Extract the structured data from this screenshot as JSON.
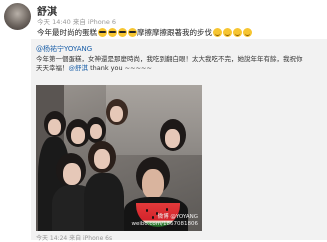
{
  "user": {
    "name": "舒淇",
    "meta": "今天 14:40 来自 iPhone 6"
  },
  "post": {
    "text": "今年最时尚的蛋糕",
    "text_after": "摩擦摩擦跟著我的步伐",
    "emojis_sunglasses": [
      "sunglasses",
      "sunglasses",
      "sunglasses",
      "sunglasses"
    ],
    "emojis_cute": [
      "cute",
      "cute",
      "cute",
      "cute"
    ]
  },
  "repost": {
    "author": "@杨祐宁YOYANG",
    "text_line1": "今年第一個蛋糕，女神還是那麼時尚，我吃到翻白眼！太大我吃不完，她說年年有餘，我祝你",
    "text_line2_prefix": "天天幸福！",
    "mention": "@舒淇",
    "text_line2_suffix": " thank you ~~~~~",
    "time": "今天 14:24 来自 iPhone 6s",
    "watermark_line1": "微博 @YOYANG",
    "watermark_line2": "weibo.com/1867081806"
  }
}
